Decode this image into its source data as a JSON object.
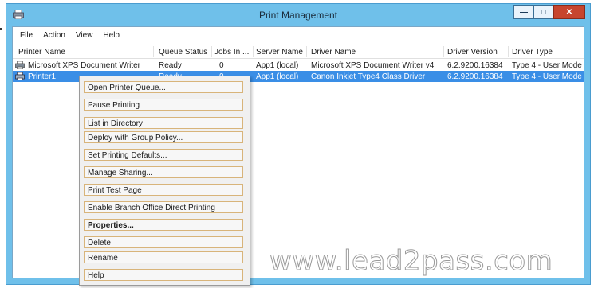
{
  "window": {
    "title": "Print Management"
  },
  "menubar": [
    "File",
    "Action",
    "View",
    "Help"
  ],
  "columns": [
    "Printer Name",
    "Queue Status",
    "Jobs In ...",
    "Server Name",
    "Driver Name",
    "Driver Version",
    "Driver Type"
  ],
  "rows": [
    [
      "Microsoft XPS Document Writer",
      "Ready",
      "0",
      "App1 (local)",
      "Microsoft XPS Document Writer v4",
      "6.2.9200.16384",
      "Type 4 - User Mode"
    ],
    [
      "Printer1",
      "Ready",
      "0",
      "App1 (local)",
      "Canon Inkjet Type4 Class Driver",
      "6.2.9200.16384",
      "Type 4 - User Mode"
    ]
  ],
  "context_menu": [
    "Open Printer Queue...",
    "Pause Printing",
    "List in Directory",
    "Deploy with Group Policy...",
    "Set Printing Defaults...",
    "Manage Sharing...",
    "Print Test Page",
    "Enable Branch Office Direct Printing",
    "Properties...",
    "Delete",
    "Rename",
    "Help"
  ],
  "watermark": "www.lead2pass.com",
  "colors": {
    "frame": "#6fc0ea",
    "selection": "#3a8ee6",
    "close": "#c7452e"
  }
}
